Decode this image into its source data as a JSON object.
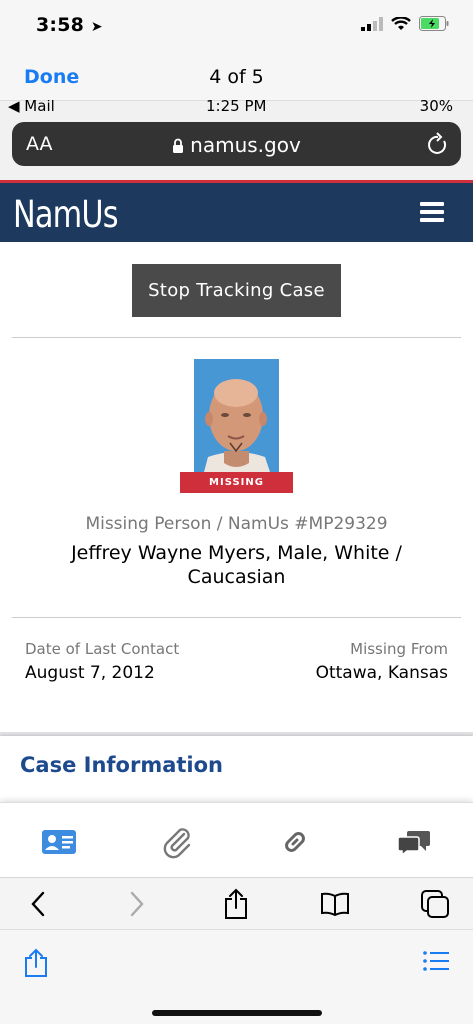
{
  "outer_status": {
    "time": "3:58"
  },
  "viewer": {
    "done_label": "Done",
    "page_counter": "4 of 5"
  },
  "inner_status": {
    "back_app": "◀ Mail",
    "time": "1:25 PM",
    "battery": "30%"
  },
  "browser": {
    "text_size_label": "AA",
    "domain": "namus.gov"
  },
  "site": {
    "logo": "NamUs"
  },
  "case": {
    "track_button": "Stop Tracking Case",
    "status_badge": "MISSING",
    "case_number": "Missing Person / NamUs #MP29329",
    "name_line1": "Jeffrey Wayne Myers, Male, White /",
    "name_line2": "Caucasian",
    "last_contact_label": "Date of Last Contact",
    "last_contact_value": "August 7, 2012",
    "missing_from_label": "Missing From",
    "missing_from_value": "Ottawa, Kansas",
    "section_title": "Case Information"
  },
  "tabs": [
    "id-card-icon",
    "paperclip-icon",
    "link-icon",
    "chat-bubbles-icon"
  ],
  "colors": {
    "brand_navy": "#1d3a5e",
    "accent_red": "#cf2f3b",
    "ios_blue": "#1a7cf2",
    "section_blue": "#1d4a8c"
  }
}
